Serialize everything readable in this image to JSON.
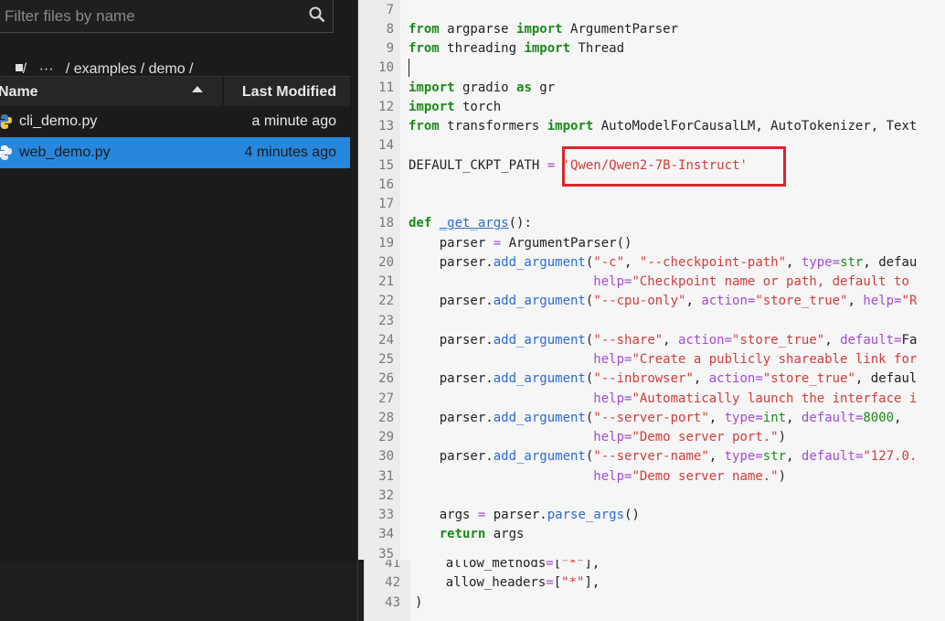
{
  "browser": {
    "filter_placeholder": "Filter files by name",
    "breadcrumb": "/   ···   / examples / demo /",
    "col_name": "Name",
    "col_modified": "Last Modified",
    "files": [
      {
        "name": "cli_demo.py",
        "modified": "a minute ago",
        "selected": false
      },
      {
        "name": "web_demo.py",
        "modified": "4 minutes ago",
        "selected": true
      }
    ]
  },
  "editor": {
    "line_numbers": [
      "7",
      "8",
      "9",
      "10",
      "11",
      "12",
      "13",
      "14",
      "15",
      "16",
      "17",
      "18",
      "19",
      "20",
      "21",
      "22",
      "23",
      "24",
      "25",
      "26",
      "27",
      "28",
      "29",
      "30",
      "31",
      "32",
      "33",
      "34",
      "35"
    ],
    "lines": [
      "",
      "from argparse import ArgumentParser",
      "from threading import Thread",
      "",
      "import gradio as gr",
      "import torch",
      "from transformers import AutoModelForCausalLM, AutoTokenizer, Text",
      "",
      "DEFAULT_CKPT_PATH = 'Qwen/Qwen2-7B-Instruct'",
      "",
      "",
      "def _get_args():",
      "    parser = ArgumentParser()",
      "    parser.add_argument(\"-c\", \"--checkpoint-path\", type=str, defau",
      "                        help=\"Checkpoint name or path, default to",
      "    parser.add_argument(\"--cpu-only\", action=\"store_true\", help=\"R",
      "",
      "    parser.add_argument(\"--share\", action=\"store_true\", default=Fa",
      "                        help=\"Create a publicly shareable link for",
      "    parser.add_argument(\"--inbrowser\", action=\"store_true\", defaul",
      "                        help=\"Automatically launch the interface i",
      "    parser.add_argument(\"--server-port\", type=int, default=8000,",
      "                        help=\"Demo server port.\")",
      "    parser.add_argument(\"--server-name\", type=str, default=\"127.0.",
      "                        help=\"Demo server name.\")",
      "",
      "    args = parser.parse_args()",
      "    return args",
      ""
    ],
    "highlighted_value": "'Qwen/Qwen2-7B-Instruct'"
  },
  "editor2": {
    "line_numbers": [
      "41",
      "42",
      "43"
    ],
    "lines": [
      "    allow_methods=[\"*\"],",
      "    allow_headers=[\"*\"],",
      ")"
    ]
  }
}
